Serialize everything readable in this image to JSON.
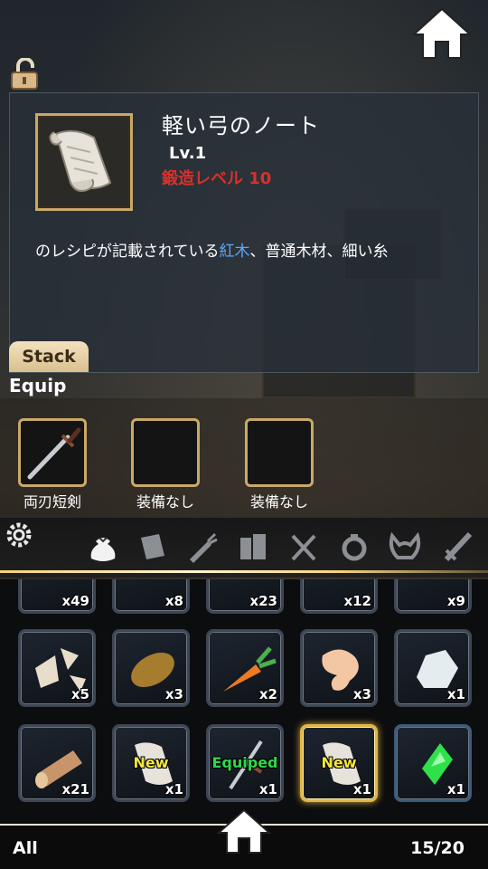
{
  "item": {
    "name": "軽い弓のノート",
    "level": "Lv.1",
    "forge_level": "鍛造レベル 10",
    "description_pre": "のレシピが記載されている",
    "description_highlight": "紅木",
    "description_post": "、普通木材、細い糸"
  },
  "stack_tab": "Stack",
  "equip_section": {
    "title": "Equip",
    "slots": [
      {
        "label": "両刃短剣",
        "icon": "dagger-icon"
      },
      {
        "label": "装備なし",
        "icon": null
      },
      {
        "label": "装備なし",
        "icon": null
      }
    ]
  },
  "category_tabs": [
    "settings-gear-icon",
    "bag-icon",
    "scroll-icon",
    "carrot-icon",
    "books-icon",
    "utensils-icon",
    "ring-icon",
    "helmet-icon",
    "sword-icon"
  ],
  "inventory": {
    "row1": [
      {
        "count": "x49"
      },
      {
        "count": "x8"
      },
      {
        "count": "x23"
      },
      {
        "count": "x12"
      },
      {
        "count": "x9"
      }
    ],
    "row2": [
      {
        "icon": "shards-icon",
        "count": "x5"
      },
      {
        "icon": "potato-icon",
        "count": "x3"
      },
      {
        "icon": "carrot-icon",
        "count": "x2"
      },
      {
        "icon": "meat-icon",
        "count": "x3"
      },
      {
        "icon": "ore-icon",
        "count": "x1"
      }
    ],
    "row3": [
      {
        "icon": "log-icon",
        "count": "x21",
        "tag": ""
      },
      {
        "icon": "scroll-icon",
        "count": "x1",
        "tag": "New"
      },
      {
        "icon": "dagger-icon",
        "count": "x1",
        "tag": "Equiped"
      },
      {
        "icon": "scroll-icon",
        "count": "x1",
        "tag": "New"
      },
      {
        "icon": "gem-icon",
        "count": "x1",
        "tag": ""
      }
    ]
  },
  "footer": {
    "filter": "All",
    "page_count": "15/20"
  },
  "colors": {
    "gold_frame": "#c9a969",
    "forge_red": "#d9302b",
    "highlight_blue": "#5aa9ff",
    "new_yellow": "#f4e640",
    "equipped_green": "#30d84a"
  }
}
